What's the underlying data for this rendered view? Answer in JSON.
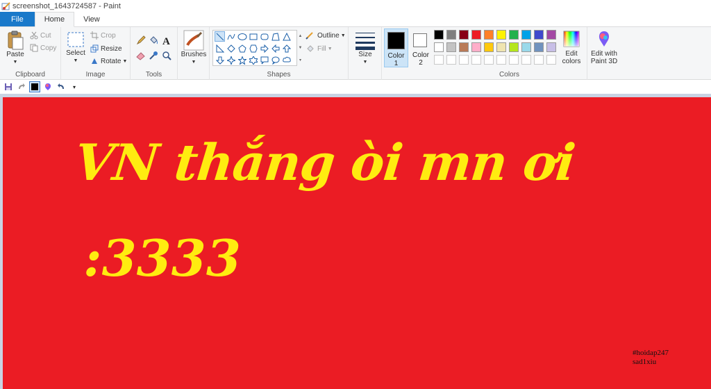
{
  "window": {
    "title": "screenshot_1643724587 - Paint"
  },
  "tabs": [
    {
      "label": "File"
    },
    {
      "label": "Home"
    },
    {
      "label": "View"
    }
  ],
  "ribbon": {
    "clipboard": {
      "paste": "Paste",
      "cut": "Cut",
      "copy": "Copy",
      "label": "Clipboard"
    },
    "image": {
      "select": "Select",
      "crop": "Crop",
      "resize": "Resize",
      "rotate": "Rotate",
      "label": "Image"
    },
    "tools": {
      "label": "Tools"
    },
    "brushes": {
      "label": "Brushes"
    },
    "shapes": {
      "outline": "Outline",
      "fill": "Fill",
      "label": "Shapes"
    },
    "size": {
      "label": "Size"
    },
    "color1": {
      "label": "Color",
      "num": "1",
      "color": "#000000"
    },
    "color2": {
      "label": "Color",
      "num": "2",
      "color": "#ffffff"
    },
    "colors": {
      "label": "Colors",
      "row1": [
        "#000000",
        "#7f7f7f",
        "#880015",
        "#ed1c24",
        "#ff7f27",
        "#fff200",
        "#22b14c",
        "#00a2e8",
        "#3f48cc",
        "#a349a4"
      ],
      "row2": [
        "#ffffff",
        "#c3c3c3",
        "#b97a57",
        "#ffaec9",
        "#ffc90e",
        "#efe4b0",
        "#b5e61d",
        "#99d9ea",
        "#7092be",
        "#c8bfe7"
      ]
    },
    "edit_colors": {
      "line1": "Edit",
      "line2": "colors"
    },
    "paint3d": {
      "line1": "Edit with",
      "line2": "Paint 3D"
    }
  },
  "canvas": {
    "background": "#eb1c24",
    "text_color": "#ffec10",
    "line1": "VN thắng òi mn ơi",
    "line2": ":3333",
    "signature_line1": "#hoidap247",
    "signature_line2": "sad1xiu"
  }
}
